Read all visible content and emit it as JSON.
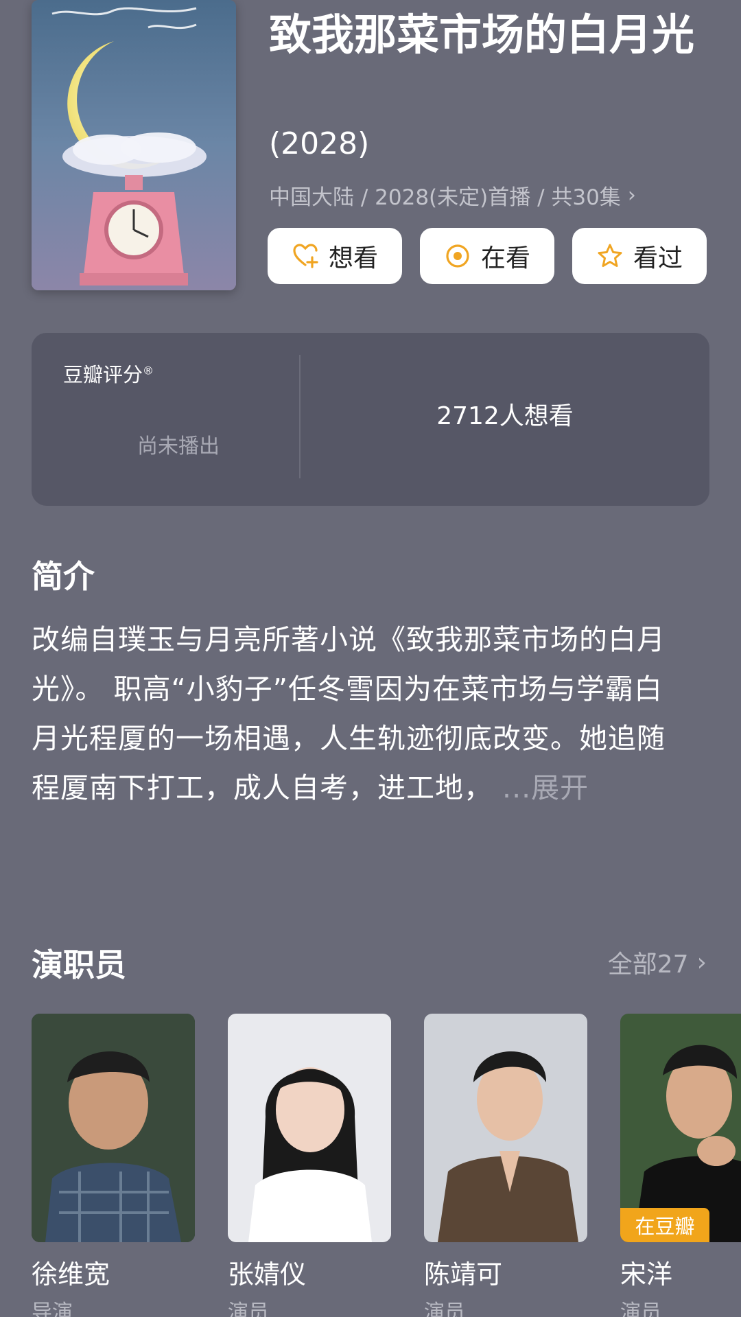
{
  "movie": {
    "title": "致我那菜市场的白月光",
    "year": "(2028)",
    "meta": "中国大陆 / 2028(未定)首播 / 共30集"
  },
  "actions": [
    {
      "label": "想看",
      "icon": "heart-plus-icon"
    },
    {
      "label": "在看",
      "icon": "target-icon"
    },
    {
      "label": "看过",
      "icon": "star-icon"
    }
  ],
  "rating": {
    "label": "豆瓣评分",
    "reg_mark": "®",
    "status": "尚未播出",
    "want_count": "2712人想看"
  },
  "intro": {
    "heading": "简介",
    "text": "改编自璞玉与月亮所著小说《致我那菜市场的白月光》。 职高“小豹子”任冬雪因为在菜市场与学霸白月光程厦的一场相遇，人生轨迹彻底改变。她追随程厦南下打工，成人自考，进工地， ",
    "expand": "...展开"
  },
  "cast": {
    "heading": "演职员",
    "all_label": "全部27",
    "members": [
      {
        "name": "徐维宽",
        "role": "导演"
      },
      {
        "name": "张婧仪",
        "role": "演员"
      },
      {
        "name": "陈靖可",
        "role": "演员"
      },
      {
        "name": "宋洋",
        "role": "演员",
        "badge": "在豆瓣"
      }
    ]
  },
  "colors": {
    "background": "#696a78",
    "card": "#565766",
    "badge": "#f1a51b",
    "accent": "#f0a522"
  }
}
